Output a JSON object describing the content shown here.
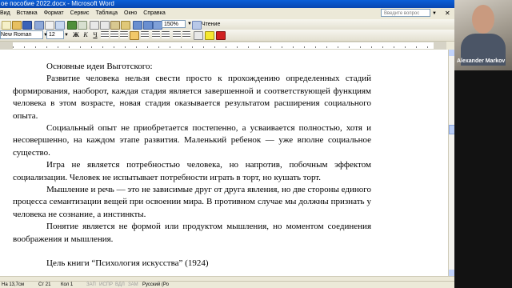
{
  "window": {
    "title": "ое пособие 2022.docx - Microsoft Word",
    "help_placeholder": "Введите вопрос",
    "close_glyph": "✕"
  },
  "menu": [
    "Вид",
    "Вставка",
    "Формат",
    "Сервис",
    "Таблица",
    "Окно",
    "Справка"
  ],
  "toolbar": {
    "zoom": "150%",
    "read_label": "Чтение",
    "font_name": "New Roman",
    "font_size": "12",
    "bold": "Ж",
    "italic": "К",
    "underline": "Ч"
  },
  "document": {
    "paragraphs": [
      "Основные идеи Выготского:",
      "Развитие человека нельзя свести просто к прохождению определенных стадий формирования, наоборот, каждая стадия является завершенной и соответствующей функциям человека в этом возрасте, новая стадия оказывается результатом расширения социального опыта.",
      "Социальный опыт не приобретается постепенно, а усваивается полностью, хотя и несовершенно, на каждом этапе развития. Маленький ребенок — уже вполне социальное существо.",
      "Игра не является потребностью человека, но напротив, побочным эффектом социализации. Человек не испытывает потребности играть в торт, но кушать торт.",
      "Мышление и речь — это не зависимые друг от друга явления, но две стороны единого процесса семантизации вещей при освоении мира. В противном случае мы должны признать у человека не сознание, а инстинкты.",
      "Понятие является не формой или продуктом мышления, но моментом соединения воображения и мышления."
    ],
    "next_heading": "Цель книги “Психология искусства” (1924)"
  },
  "status": {
    "position": "На 13,7см",
    "line": "Ст 21",
    "column": "Кол 1",
    "rec": "ЗАП",
    "trk": "ИСПР",
    "ext": "ВДЛ",
    "ovr": "ЗАМ",
    "language": "Русский (Ро"
  },
  "video": {
    "participant_name": "Alexander Markov"
  },
  "colors": {
    "titlebar": "#0a5fd8",
    "chrome": "#ece9d8"
  }
}
